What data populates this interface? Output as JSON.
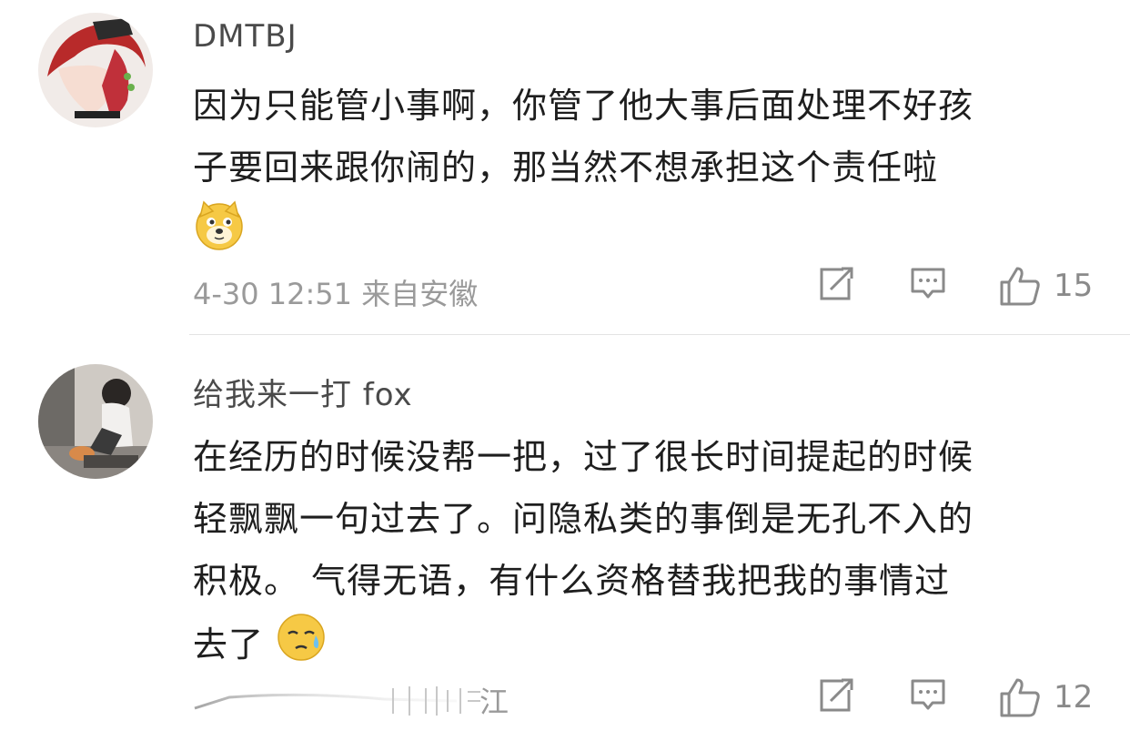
{
  "comments": [
    {
      "username": "DMTBJ",
      "lines": [
        "因为只能管小事啊，你管了他大事后面处理不好孩",
        "子要回来跟你闹的，那当然不想承担这个责任啦"
      ],
      "emoji": "doge-emoji",
      "timestamp": "4-30 12:51 来自安徽",
      "like_count": "15"
    },
    {
      "username": "给我来一打 fox",
      "lines": [
        "在经历的时候没帮一把，过了很长时间提起的时候",
        "轻飘飘一句过去了。问隐私类的事倒是无孔不入的",
        "积极。 气得无语，有什么资格替我把我的事情过",
        "去了"
      ],
      "emoji": "sweat-emoji",
      "timestamp_visible_fragment": "江",
      "like_count": "12"
    }
  ],
  "icons": {
    "repost": "repost-icon",
    "reply": "comment-icon",
    "like": "thumbs-up-icon"
  },
  "colors": {
    "text": "#1e1e1e",
    "muted": "#9a9a9a",
    "divider": "#e4e4e4",
    "emoji_yellow": "#f6c945"
  }
}
